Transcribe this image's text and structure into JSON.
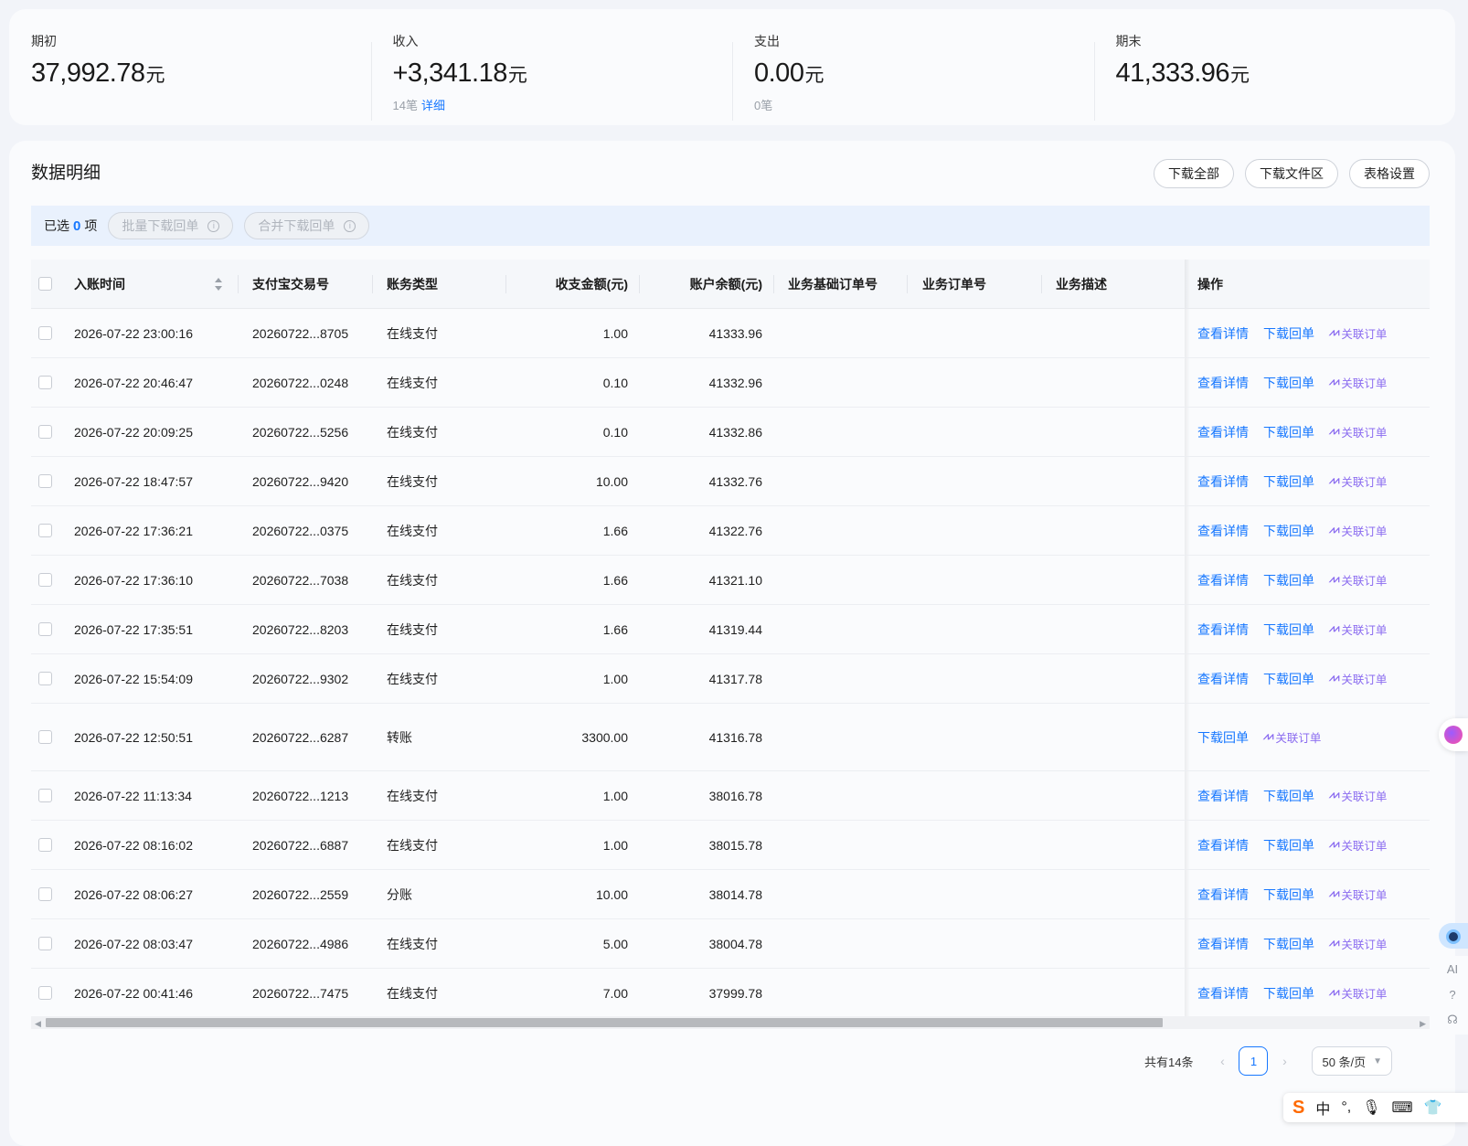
{
  "summary": [
    {
      "label": "期初",
      "value": "37,992.78",
      "unit": "元",
      "sub": "",
      "link": ""
    },
    {
      "label": "收入",
      "value": "+3,341.18",
      "unit": "元",
      "sub": "14笔",
      "link": "详细"
    },
    {
      "label": "支出",
      "value": "0.00",
      "unit": "元",
      "sub": "0笔",
      "link": ""
    },
    {
      "label": "期末",
      "value": "41,333.96",
      "unit": "元",
      "sub": "",
      "link": ""
    }
  ],
  "detail": {
    "title": "数据明细",
    "buttons": [
      "下载全部",
      "下载文件区",
      "表格设置"
    ]
  },
  "selection": {
    "prefix": "已选",
    "count": "0",
    "suffix": "项",
    "batch_download": "批量下载回单",
    "merge_download": "合并下载回单"
  },
  "table": {
    "headers": {
      "time": "入账时间",
      "trade_no": "支付宝交易号",
      "type": "账务类型",
      "amount": "收支金额(元)",
      "balance": "账户余额(元)",
      "base_order": "业务基础订单号",
      "order": "业务订单号",
      "desc": "业务描述",
      "op": "操作"
    },
    "ops": {
      "view": "查看详情",
      "download": "下载回单",
      "link": "关联订单"
    },
    "rows": [
      {
        "time": "2026-07-22 23:00:16",
        "trade_no": "20260722...8705",
        "type": "在线支付",
        "amount": "1.00",
        "balance": "41333.96",
        "has_view": true
      },
      {
        "time": "2026-07-22 20:46:47",
        "trade_no": "20260722...0248",
        "type": "在线支付",
        "amount": "0.10",
        "balance": "41332.96",
        "has_view": true
      },
      {
        "time": "2026-07-22 20:09:25",
        "trade_no": "20260722...5256",
        "type": "在线支付",
        "amount": "0.10",
        "balance": "41332.86",
        "has_view": true
      },
      {
        "time": "2026-07-22 18:47:57",
        "trade_no": "20260722...9420",
        "type": "在线支付",
        "amount": "10.00",
        "balance": "41332.76",
        "has_view": true
      },
      {
        "time": "2026-07-22 17:36:21",
        "trade_no": "20260722...0375",
        "type": "在线支付",
        "amount": "1.66",
        "balance": "41322.76",
        "has_view": true
      },
      {
        "time": "2026-07-22 17:36:10",
        "trade_no": "20260722...7038",
        "type": "在线支付",
        "amount": "1.66",
        "balance": "41321.10",
        "has_view": true
      },
      {
        "time": "2026-07-22 17:35:51",
        "trade_no": "20260722...8203",
        "type": "在线支付",
        "amount": "1.66",
        "balance": "41319.44",
        "has_view": true
      },
      {
        "time": "2026-07-22 15:54:09",
        "trade_no": "20260722...9302",
        "type": "在线支付",
        "amount": "1.00",
        "balance": "41317.78",
        "has_view": true
      },
      {
        "time": "2026-07-22 12:50:51",
        "trade_no": "20260722...6287",
        "type": "转账",
        "amount": "3300.00",
        "balance": "41316.78",
        "has_view": false
      },
      {
        "time": "2026-07-22 11:13:34",
        "trade_no": "20260722...1213",
        "type": "在线支付",
        "amount": "1.00",
        "balance": "38016.78",
        "has_view": true
      },
      {
        "time": "2026-07-22 08:16:02",
        "trade_no": "20260722...6887",
        "type": "在线支付",
        "amount": "1.00",
        "balance": "38015.78",
        "has_view": true
      },
      {
        "time": "2026-07-22 08:06:27",
        "trade_no": "20260722...2559",
        "type": "分账",
        "amount": "10.00",
        "balance": "38014.78",
        "has_view": true
      },
      {
        "time": "2026-07-22 08:03:47",
        "trade_no": "20260722...4986",
        "type": "在线支付",
        "amount": "5.00",
        "balance": "38004.78",
        "has_view": true
      },
      {
        "time": "2026-07-22 00:41:46",
        "trade_no": "20260722...7475",
        "type": "在线支付",
        "amount": "7.00",
        "balance": "37999.78",
        "has_view": true
      }
    ]
  },
  "pagination": {
    "total": "共有14条",
    "current": "1",
    "page_size": "50 条/页"
  },
  "side_tools": {
    "ai": "AI"
  },
  "ime": {
    "lang": "中"
  }
}
